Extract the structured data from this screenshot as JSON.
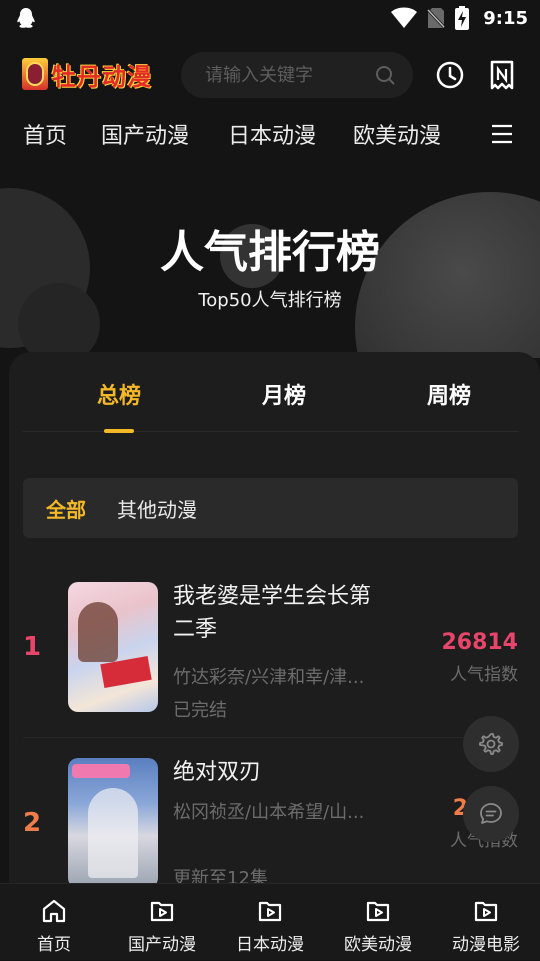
{
  "status_bar": {
    "time": "9:15"
  },
  "header": {
    "logo_text": "牡丹动漫",
    "search_placeholder": "请输入关键字"
  },
  "nav": {
    "items": [
      "首页",
      "国产动漫",
      "日本动漫",
      "欧美动漫"
    ]
  },
  "hero": {
    "title": "人气排行榜",
    "subtitle": "Top50人气排行榜"
  },
  "tabs": [
    "总榜",
    "月榜",
    "周榜"
  ],
  "active_tab": "总榜",
  "filters": [
    "全部",
    "其他动漫"
  ],
  "active_filter": "全部",
  "rankings": [
    {
      "rank": "1",
      "title": "我老婆是学生会长第二季",
      "authors": "竹达彩奈/兴津和幸/津...",
      "status": "已完结",
      "score": "26814",
      "score_label": "人气指数"
    },
    {
      "rank": "2",
      "title": "绝对双刃",
      "authors": "松冈祯丞/山本希望/山...",
      "status": "更新至12集",
      "score": "2",
      "score_label": "人气指数"
    }
  ],
  "bottom_nav": [
    "首页",
    "国产动漫",
    "日本动漫",
    "欧美动漫",
    "动漫电影"
  ],
  "colors": {
    "accent": "#f5b928",
    "rank1": "#e8456a",
    "rank2": "#f07c4a",
    "score1": "#e8456a",
    "score2": "#f07c4a",
    "background": "#141414"
  }
}
